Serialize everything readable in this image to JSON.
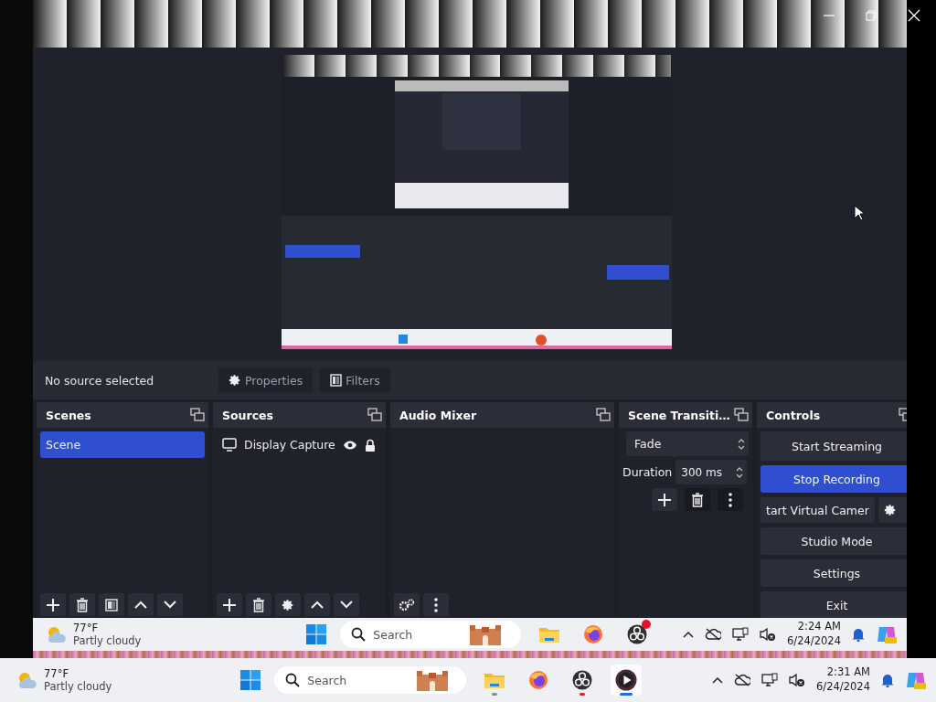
{
  "source_bar": {
    "status": "No source selected",
    "buttons": [
      {
        "label": "Properties",
        "kind": "properties"
      },
      {
        "label": "Filters",
        "kind": "filters"
      }
    ]
  },
  "scenes": {
    "title": "Scenes",
    "items": [
      {
        "label": "Scene",
        "selected": true
      }
    ]
  },
  "sources": {
    "title": "Sources",
    "items": [
      {
        "label": "Display Capture",
        "visible": true,
        "locked": true
      }
    ]
  },
  "audio_mixer": {
    "title": "Audio Mixer"
  },
  "scene_transitions": {
    "title": "Scene Transiti…",
    "transition": "Fade",
    "duration_label": "Duration",
    "duration": "300 ms"
  },
  "controls": {
    "title": "Controls",
    "buttons": [
      {
        "label": "Start Streaming",
        "active": false,
        "kind": "plain"
      },
      {
        "label": "Stop Recording",
        "active": true,
        "kind": "plain"
      },
      {
        "label": "tart Virtual Camer",
        "active": false,
        "kind": "with-settings"
      },
      {
        "label": "Studio Mode",
        "active": false,
        "kind": "plain"
      },
      {
        "label": "Settings",
        "active": false,
        "kind": "plain"
      },
      {
        "label": "Exit",
        "active": false,
        "kind": "plain"
      }
    ]
  },
  "inner_taskbar": {
    "temperature": "77°F",
    "weather": "Partly cloudy",
    "search": {
      "placeholder": "Search"
    },
    "apps": [
      {
        "kind": "explorer",
        "running": false,
        "active": false,
        "recording": false,
        "badge": false
      },
      {
        "kind": "firefox",
        "running": false,
        "active": false,
        "recording": false,
        "badge": false
      },
      {
        "kind": "obs",
        "running": false,
        "active": false,
        "recording": false,
        "badge": true
      }
    ],
    "time": "2:24 AM",
    "date": "6/24/2024"
  },
  "taskbar": {
    "temperature": "77°F",
    "weather": "Partly cloudy",
    "search": {
      "placeholder": "Search"
    },
    "apps": [
      {
        "kind": "explorer",
        "running": true,
        "active": false,
        "recording": false,
        "badge": false
      },
      {
        "kind": "firefox",
        "running": false,
        "active": false,
        "recording": false,
        "badge": false
      },
      {
        "kind": "obs",
        "running": true,
        "active": false,
        "recording": true,
        "badge": false
      },
      {
        "kind": "player",
        "running": true,
        "active": true,
        "recording": false,
        "badge": false
      }
    ],
    "time": "2:31 AM",
    "date": "6/24/2024"
  }
}
